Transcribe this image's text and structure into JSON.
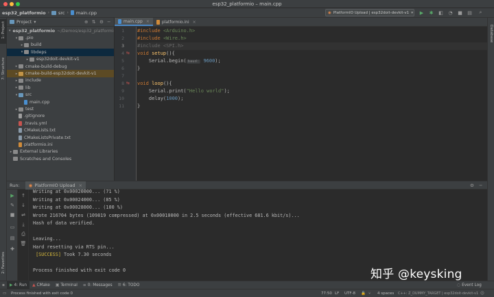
{
  "window": {
    "title": "esp32_platformio – main.cpp"
  },
  "navbar": {
    "breadcrumbs": [
      "esp32_platformio",
      "src",
      "main.cpp"
    ],
    "run_config": "PlatformIO Upload | esp32doit-devkit-v1"
  },
  "left_strip": {
    "project_tab": "1: Project",
    "structure_tab": "7: Structure",
    "favorites_tab": "2: Favorites"
  },
  "right_strip": {
    "database_tab": "Database"
  },
  "project": {
    "header": "Project",
    "tree": [
      {
        "label": "esp32_platformio",
        "extra": "~/Demos/esp32_platformio",
        "indent": 0,
        "arrow": "▾",
        "icon": "folder"
      },
      {
        "label": ".pio",
        "indent": 1,
        "arrow": "▾",
        "icon": "folder"
      },
      {
        "label": "build",
        "indent": 2,
        "arrow": "▸",
        "icon": "folder"
      },
      {
        "label": "libdeps",
        "indent": 2,
        "arrow": "▾",
        "icon": "folder",
        "selected": true
      },
      {
        "label": "esp32doit-devkit-v1",
        "indent": 3,
        "arrow": "▸",
        "icon": "folder"
      },
      {
        "label": "cmake-build-debug",
        "indent": 1,
        "arrow": "▸",
        "icon": "folder"
      },
      {
        "label": "cmake-build-esp32doit-devkit-v1",
        "indent": 1,
        "arrow": "▸",
        "icon": "folder-orange",
        "highlight": true
      },
      {
        "label": "include",
        "indent": 1,
        "arrow": "▸",
        "icon": "folder"
      },
      {
        "label": "lib",
        "indent": 1,
        "arrow": "▸",
        "icon": "folder"
      },
      {
        "label": "src",
        "indent": 1,
        "arrow": "▾",
        "icon": "folder-blue"
      },
      {
        "label": "main.cpp",
        "indent": 2,
        "arrow": "",
        "icon": "file-cpp"
      },
      {
        "label": "test",
        "indent": 1,
        "arrow": "▸",
        "icon": "folder"
      },
      {
        "label": ".gitignore",
        "indent": 1,
        "arrow": "",
        "icon": "file-git"
      },
      {
        "label": ".travis.yml",
        "indent": 1,
        "arrow": "",
        "icon": "file-yml"
      },
      {
        "label": "CMakeLists.txt",
        "indent": 1,
        "arrow": "",
        "icon": "file-txt"
      },
      {
        "label": "CMakeListsPrivate.txt",
        "indent": 1,
        "arrow": "",
        "icon": "file-txt"
      },
      {
        "label": "platformio.ini",
        "indent": 1,
        "arrow": "",
        "icon": "file-ini"
      },
      {
        "label": "External Libraries",
        "indent": 0,
        "arrow": "▸",
        "icon": "folder"
      },
      {
        "label": "Scratches and Consoles",
        "indent": 0,
        "arrow": "",
        "icon": "folder"
      }
    ]
  },
  "editor": {
    "tabs": [
      {
        "label": "main.cpp",
        "active": true
      },
      {
        "label": "platformio.ini",
        "active": false
      }
    ],
    "line_numbers": [
      "1",
      "2",
      "3",
      "4",
      "5",
      "6",
      "7",
      "8",
      "9",
      "10",
      "11"
    ],
    "hint_baud": "baud:",
    "code": {
      "l1_kw": "#include",
      "l1_arg": "<Arduino.h>",
      "l2_kw": "#include",
      "l2_arg": "<Wire.h>",
      "l3_text": "#include <SPI.h>",
      "l4_kw": "void",
      "l4_fn": "setup",
      "l4_rest": "(){",
      "l5_pre": "    Serial.begin(",
      "l5_num": "9600",
      "l5_post": ");",
      "l6": "}",
      "l8_kw": "void",
      "l8_fn": "loop",
      "l8_rest": "(){",
      "l9_pre": "    Serial.print(",
      "l9_str": "\"Hello world\"",
      "l9_post": ");",
      "l10_pre": "    delay(",
      "l10_num": "1000",
      "l10_post": ");",
      "l11": "}"
    }
  },
  "run": {
    "label": "Run:",
    "tab": "PlatformIO Upload",
    "console": [
      "Writing at 0x00020000... (71 %)",
      "Writing at 0x00024000... (85 %)",
      "Writing at 0x00028000... (100 %)",
      "Wrote 216704 bytes (109819 compressed) at 0x00010000 in 2.5 seconds (effective 681.6 kbit/s)...",
      "Hash of data verified.",
      "",
      "Leaving...",
      "Hard resetting via RTS pin...",
      "",
      "",
      "Process finished with exit code 0"
    ],
    "success_tag": "[SUCCESS]",
    "success_rest": " Took 7.30 seconds"
  },
  "watermark": "知乎 @keysking",
  "bottom_tabs": [
    {
      "label": "4: Run",
      "active": true
    },
    {
      "label": "CMake",
      "active": false
    },
    {
      "label": "Terminal",
      "active": false
    },
    {
      "label": "0: Messages",
      "active": false
    },
    {
      "label": "6: TODO",
      "active": false
    }
  ],
  "event_log": "Event Log",
  "status": {
    "message": "Process finished with exit code 0",
    "position": "77:50",
    "line_sep": "LF",
    "encoding": "UTF-8",
    "indent": "4 spaces",
    "context": "C++: Z_DUMMY_TARGET | esp32doit-devkit-v1"
  }
}
